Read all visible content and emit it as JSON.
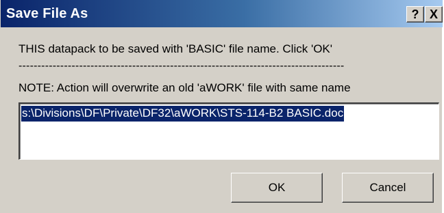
{
  "window": {
    "title": "Save File As",
    "help_label": "?",
    "close_label": "X"
  },
  "message": {
    "line1": "THIS datapack to be saved with 'BASIC' file name.  Click 'OK'",
    "separator": "--------------------------------------------------------------------------------------",
    "line2": "NOTE: Action will overwrite an old 'aWORK' file with same name"
  },
  "path_field": {
    "value": "s:\\Divisions\\DF\\Private\\DF32\\aWORK\\STS-114-B2 BASIC.doc"
  },
  "buttons": {
    "ok": "OK",
    "cancel": "Cancel"
  },
  "colors": {
    "titlebar_start": "#0a246a",
    "titlebar_end": "#a6caf0",
    "dialog_face": "#d4d0c8",
    "selection": "#0a246a"
  }
}
